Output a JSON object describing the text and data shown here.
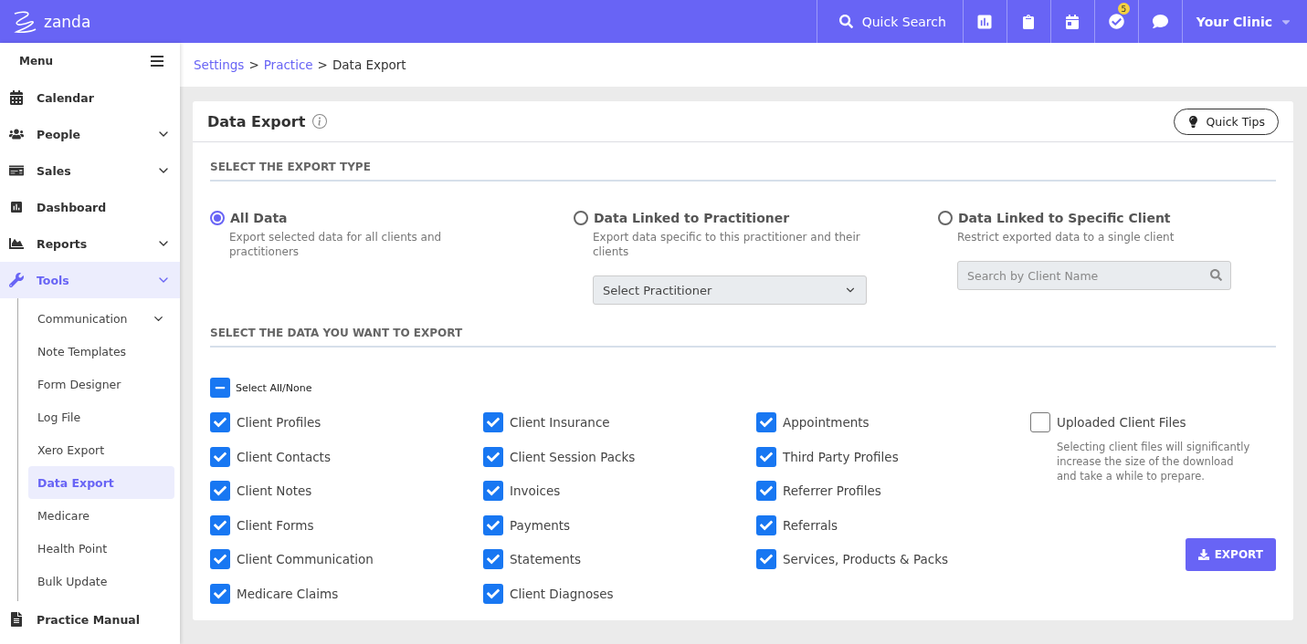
{
  "topbar": {
    "logo": "zanda",
    "quick_search": "Quick Search",
    "badge": "5",
    "clinic": "Your Clinic"
  },
  "sidebar": {
    "title": "Menu",
    "items": [
      {
        "label": "Calendar",
        "selected": false
      },
      {
        "label": "People",
        "selected": false,
        "kind": "group"
      },
      {
        "label": "Sales",
        "selected": false,
        "kind": "group"
      },
      {
        "label": "Dashboard",
        "selected": false
      },
      {
        "label": "Reports",
        "selected": false,
        "kind": "group"
      },
      {
        "label": "Tools",
        "selected": true,
        "kind": "group",
        "expanded": true,
        "children": [
          {
            "label": "Communication",
            "selected": false,
            "kind": "group"
          },
          {
            "label": "Note Templates",
            "selected": false
          },
          {
            "label": "Form Designer",
            "selected": false
          },
          {
            "label": "Log File",
            "selected": false
          },
          {
            "label": "Xero Export",
            "selected": false
          },
          {
            "label": "Data Export",
            "selected": true
          },
          {
            "label": "Medicare",
            "selected": false
          },
          {
            "label": "Health Point",
            "selected": false
          },
          {
            "label": "Bulk Update",
            "selected": false
          }
        ]
      },
      {
        "label": "Practice Manual",
        "selected": false
      }
    ]
  },
  "breadcrumb": [
    {
      "label": "Settings",
      "kind": "link"
    },
    {
      "label": ">",
      "kind": "separator"
    },
    {
      "label": "Practice",
      "kind": "link"
    },
    {
      "label": ">",
      "kind": "separator"
    },
    {
      "label": "Data Export",
      "kind": "current"
    }
  ],
  "panel": {
    "title": "Data Export",
    "quick_tips": "Quick Tips",
    "export_type_heading": "SELECT THE EXPORT TYPE",
    "export_types": [
      {
        "label": "All Data",
        "description": "Export selected data for all clients and practitioners",
        "selected": true,
        "kind": "plain"
      },
      {
        "label": "Data Linked to Practitioner",
        "description": "Export data specific to this practitioner and their clients",
        "selected": false,
        "kind": "select",
        "value": "Select Practitioner"
      },
      {
        "label": "Data Linked to Specific Client",
        "description": "Restrict exported data to a single client",
        "selected": false,
        "kind": "search",
        "placeholder": "Search by Client Name"
      }
    ],
    "data_heading": "SELECT THE DATA YOU WANT TO EXPORT",
    "select_all": {
      "label": "Select All/None",
      "indeterminate": true
    },
    "columns": [
      [
        {
          "label": "Client Profiles",
          "checked": true
        },
        {
          "label": "Client Contacts",
          "checked": true
        },
        {
          "label": "Client Notes",
          "checked": true
        },
        {
          "label": "Client Forms",
          "checked": true
        },
        {
          "label": "Client Communication",
          "checked": true
        },
        {
          "label": "Medicare Claims",
          "checked": true
        }
      ],
      [
        {
          "label": "Client Insurance",
          "checked": true
        },
        {
          "label": "Client Session Packs",
          "checked": true
        },
        {
          "label": "Invoices",
          "checked": true
        },
        {
          "label": "Payments",
          "checked": true
        },
        {
          "label": "Statements",
          "checked": true
        },
        {
          "label": "Client Diagnoses",
          "checked": true
        }
      ],
      [
        {
          "label": "Appointments",
          "checked": true
        },
        {
          "label": "Third Party Profiles",
          "checked": true
        },
        {
          "label": "Referrer Profiles",
          "checked": true
        },
        {
          "label": "Referrals",
          "checked": true
        },
        {
          "label": "Services, Products & Packs",
          "checked": true
        }
      ]
    ],
    "files": {
      "label": "Uploaded Client Files",
      "checked": false,
      "note": "Selecting client files will significantly increase the size of the download and take a while to prepare."
    },
    "export_button": "EXPORT"
  }
}
